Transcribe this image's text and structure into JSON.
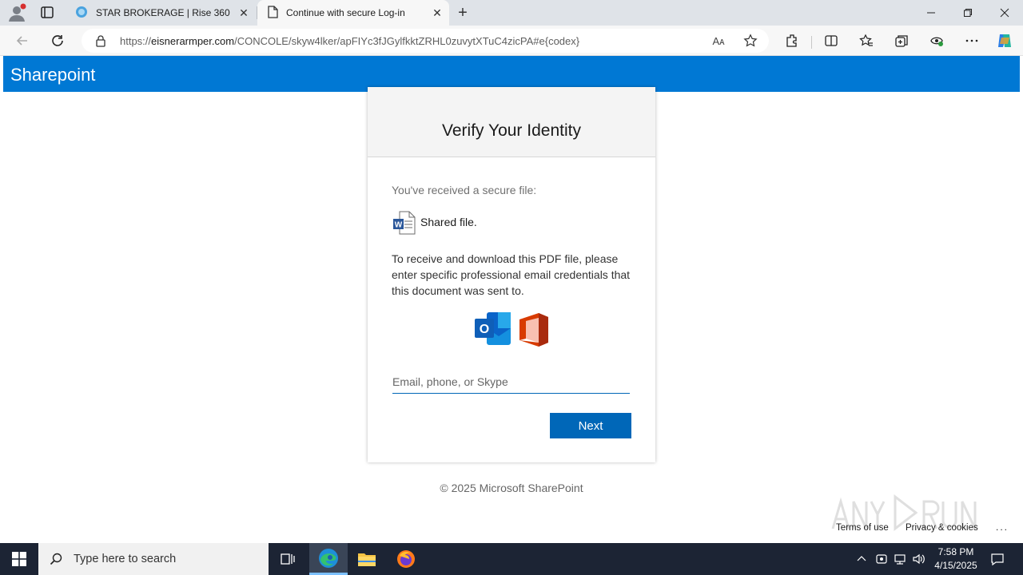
{
  "browser": {
    "tabs": [
      {
        "title": "STAR BROKERAGE | Rise 360",
        "active": false,
        "icon": "rise-360-icon"
      },
      {
        "title": "Continue with secure Log-in",
        "active": true,
        "icon": "page-icon"
      }
    ],
    "url_prefix": "https://",
    "url_host": "eisnerarmper.com",
    "url_path": "/CONCOLE/skyw4lker/apFIYc3fJGylfkktZRHL0zuvytXTuC4zicPA#e{codex}",
    "read_aloud_label": "Aᴀ"
  },
  "page": {
    "brand": "Sharepoint",
    "card": {
      "title": "Verify Your Identity",
      "received_text": "You've received a secure file:",
      "shared_file_label": "Shared file.",
      "instructions": "To receive and download this PDF file, please enter specific professional email credentials that this document was sent to.",
      "email_placeholder": "Email, phone, or Skype",
      "email_value": "",
      "next_label": "Next"
    },
    "copyright": "© 2025 Microsoft SharePoint",
    "footer_links": {
      "terms": "Terms of use",
      "privacy": "Privacy & cookies",
      "more": "..."
    }
  },
  "taskbar": {
    "search_placeholder": "Type here to search",
    "time": "7:58 PM",
    "date": "4/15/2025"
  },
  "colors": {
    "sharepoint_blue": "#0078d4",
    "button_blue": "#0067b8",
    "taskbar": "#1c2434"
  }
}
